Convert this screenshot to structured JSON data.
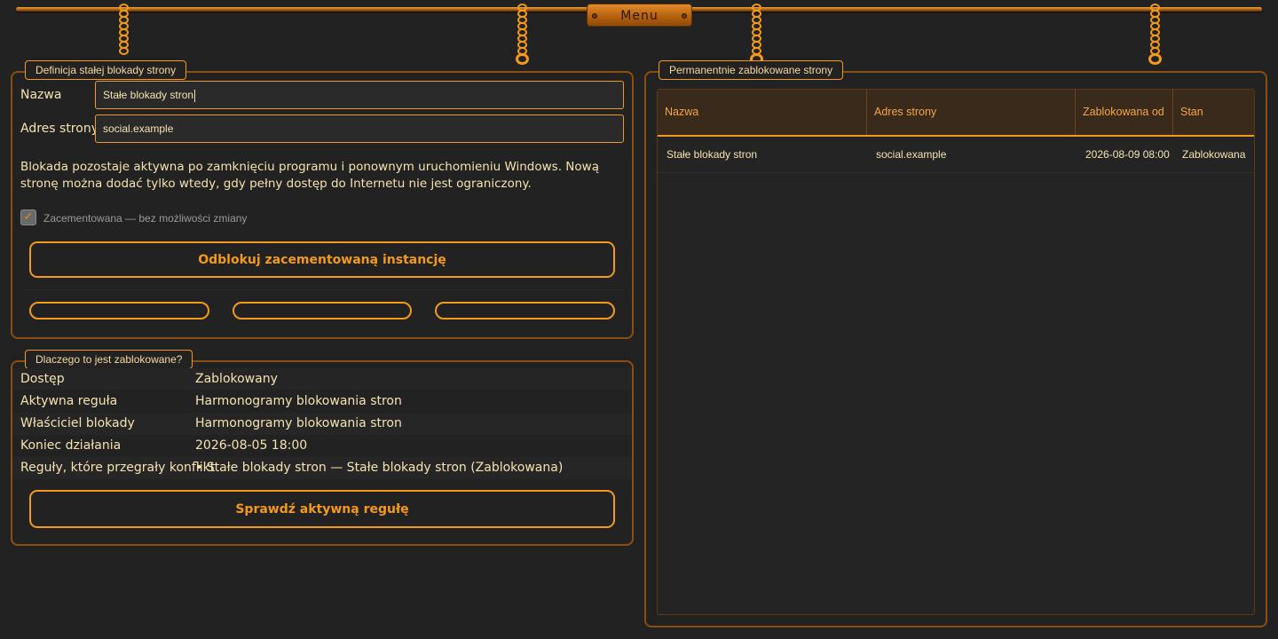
{
  "menu": {
    "label": "Menu"
  },
  "definition": {
    "title": "Definicja stałej blokady strony",
    "name_label": "Nazwa",
    "name_value": "Stałe blokady stron",
    "address_label": "Adres strony",
    "address_value": "social.example",
    "info_text": "Blokada pozostaje aktywna po zamknięciu programu i ponownym uruchomieniu Windows. Nową stronę można dodać tylko wtedy, gdy pełny dostęp do Internetu nie jest ograniczony.",
    "cemented_label": "Zacementowana — bez możliwości zmiany",
    "cemented_checked": true,
    "unlock_button": "Odblokuj zacementowaną instancję"
  },
  "why": {
    "title": "Dlaczego to jest zablokowane?",
    "rows": [
      {
        "key": "Dostęp",
        "value": "Zablokowany"
      },
      {
        "key": "Aktywna reguła",
        "value": "Harmonogramy blokowania stron"
      },
      {
        "key": "Właściciel blokady",
        "value": "Harmonogramy blokowania stron"
      },
      {
        "key": "Koniec działania",
        "value": "2026-08-05 18:00"
      },
      {
        "key": "Reguły, które przegrały konflikt",
        "value": "• Stałe blokady stron — Stałe blokady stron (Zablokowana)"
      }
    ],
    "check_button": "Sprawdź aktywną regułę"
  },
  "blocked": {
    "title": "Permanentnie zablokowane strony",
    "columns": [
      "Nazwa",
      "Adres strony",
      "Zablokowana od",
      "Stan"
    ],
    "rows": [
      [
        "Stałe blokady stron",
        "social.example",
        "2026-08-09 08:00",
        "Zablokowana"
      ]
    ]
  },
  "colors": {
    "accent": "#f39a1c",
    "background": "#222222",
    "text": "#f4e3b0"
  }
}
